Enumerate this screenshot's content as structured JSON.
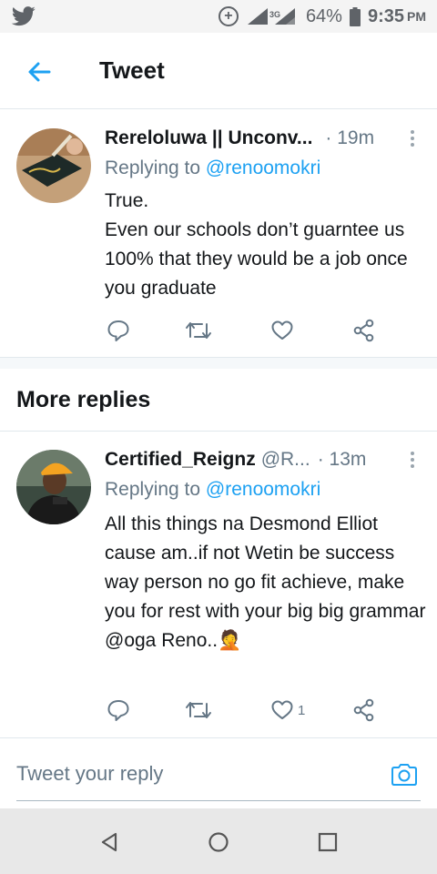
{
  "status_bar": {
    "app_icon": "twitter-bird-icon",
    "network_label": "3G",
    "battery": "64%",
    "time": "9:35",
    "ampm": "PM"
  },
  "header": {
    "title": "Tweet",
    "back_icon": "back-arrow-icon"
  },
  "tweets": [
    {
      "name": "Rereloluwa || Unconv...",
      "handle": "",
      "time": "· 19m",
      "replying_prefix": "Replying to ",
      "replying_to": "@renoomokri",
      "text": "True.\nEven our schools don’t guarntee us 100% that they would be a job once you graduate",
      "like_count": ""
    },
    {
      "name": "Certified_Reignz",
      "handle": "@R...",
      "time": "· 13m",
      "replying_prefix": "Replying to ",
      "replying_to": "@renoomokri",
      "text": "All this things na Desmond Elliot cause am..if not Wetin be success way person no go fit achieve, make you for rest with your big big grammar @oga Reno..🤦",
      "like_count": "1"
    }
  ],
  "sections": {
    "more_replies": "More replies"
  },
  "reply_bar": {
    "placeholder": "Tweet your reply",
    "camera_icon": "camera-icon"
  },
  "colors": {
    "accent": "#1da1f2",
    "muted": "#657786",
    "text": "#14171a"
  }
}
